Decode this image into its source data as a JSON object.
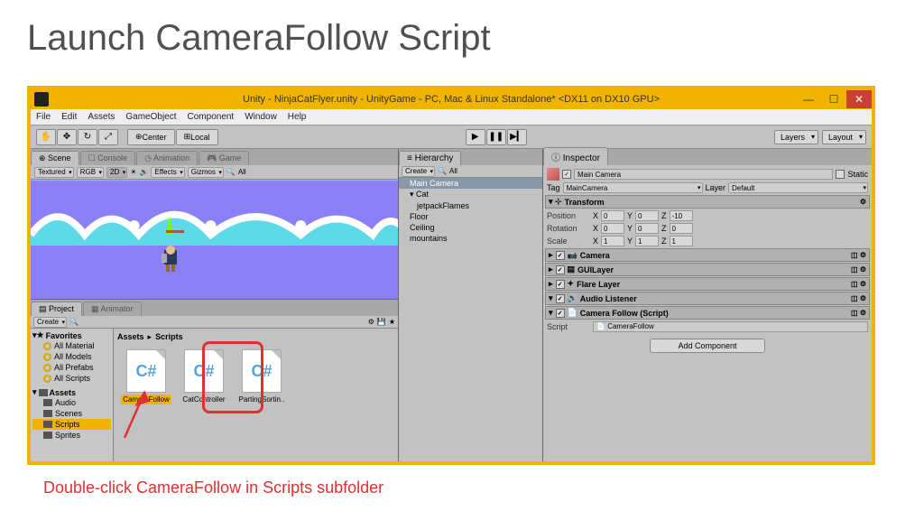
{
  "slide": {
    "title": "Launch CameraFollow Script"
  },
  "window": {
    "title": "Unity - NinjaCatFlyer.unity - UnityGame - PC, Mac & Linux Standalone* <DX11 on DX10 GPU>"
  },
  "menu": [
    "File",
    "Edit",
    "Assets",
    "GameObject",
    "Component",
    "Window",
    "Help"
  ],
  "toolbar": {
    "hand": "✋",
    "move": "✥",
    "rotate": "↻",
    "scale": "⤢",
    "center": "Center",
    "local": "Local",
    "play": "▶",
    "pause": "❚❚",
    "step": "▶▎",
    "layers": "Layers",
    "layout": "Layout"
  },
  "scene": {
    "tabs": [
      "Scene",
      "Console",
      "Animation",
      "Game"
    ],
    "textured": "Textured",
    "rgb": "RGB",
    "mode2d": "2D",
    "effects": "Effects",
    "gizmos": "Gizmos",
    "all": "All"
  },
  "project": {
    "tabs": [
      "Project",
      "Animator"
    ],
    "create": "Create",
    "favorites": "Favorites",
    "fav_items": [
      "All Material",
      "All Models",
      "All Prefabs",
      "All Scripts"
    ],
    "assets": "Assets",
    "folders": [
      "Audio",
      "Scenes",
      "Scripts",
      "Sprites"
    ],
    "breadcrumb": [
      "Assets",
      "Scripts"
    ],
    "files": [
      "CameraFollow",
      "CatController",
      "PartingSortin.."
    ],
    "csharp": "C#"
  },
  "hierarchy": {
    "title": "Hierarchy",
    "create": "Create",
    "all": "All",
    "items": [
      "Main Camera",
      "Cat",
      "jetpackFlames",
      "Floor",
      "Ceiling",
      "mountains"
    ]
  },
  "inspector": {
    "title": "Inspector",
    "name": "Main Camera",
    "static": "Static",
    "tag_label": "Tag",
    "tag": "MainCamera",
    "layer_label": "Layer",
    "layer": "Default",
    "transform": "Transform",
    "pos": "Position",
    "rot": "Rotation",
    "scale": "Scale",
    "x": "X",
    "y": "Y",
    "z": "Z",
    "px": "0",
    "py": "0",
    "pz": "-10",
    "rx": "0",
    "ry": "0",
    "rz": "0",
    "sx": "1",
    "sy": "1",
    "sz": "1",
    "camera": "Camera",
    "guilayer": "GUILayer",
    "flare": "Flare Layer",
    "audio": "Audio Listener",
    "script_comp": "Camera Follow (Script)",
    "script_label": "Script",
    "script_val": "CameraFollow",
    "add": "Add Component"
  },
  "annotation": {
    "text": "Double-click CameraFollow in Scripts subfolder"
  }
}
